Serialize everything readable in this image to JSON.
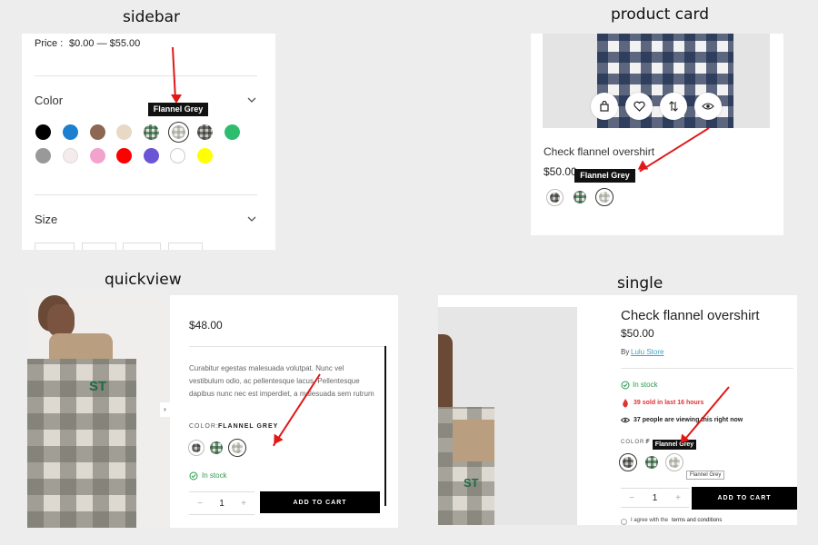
{
  "sections": {
    "sidebar": "sidebar",
    "product_card": "product card",
    "quickview": "quickview",
    "single": "single"
  },
  "sidebar": {
    "price_label": "Price :",
    "price_range": "$0.00 — $55.00",
    "color_heading": "Color",
    "size_heading": "Size",
    "tooltip": "Flannel Grey",
    "swatches": [
      "#000000",
      "#1c7fd0",
      "#8c6752",
      "#e7d9c6",
      "check-green",
      "check-grey",
      "check-black",
      "#2ebd6f",
      "#999999",
      "#f4ecec",
      "#f2a2cc",
      "#ff0000",
      "#6a55d6",
      "#ffffff",
      "#ffff00"
    ]
  },
  "product_card": {
    "name": "Check flannel overshirt",
    "price": "$50.00",
    "tooltip": "Flannel Grey",
    "icons": [
      "shopping-bag-icon",
      "heart-icon",
      "compare-icon",
      "eye-icon"
    ]
  },
  "quickview": {
    "price": "$48.00",
    "description": "Curabitur egestas malesuada volutpat. Nunc vel vestibulum odio, ac pellentesque lacus. Pellentesque dapibus nunc nec est imperdiet, a malesuada sem rutrum",
    "color_label": "COLOR:",
    "color_value": "FLANNEL GREY",
    "stock": "In stock",
    "qty": "1",
    "add_to_cart": "ADD TO CART"
  },
  "single": {
    "title": "Check flannel overshirt",
    "price": "$50.00",
    "by_label": "By",
    "vendor": "Lulu Store",
    "stock": "In stock",
    "sold": "39 sold in last 16 hours",
    "viewing": "37 people are viewing this right now",
    "color_label": "COLOR:",
    "color_value_partial": "F",
    "tooltip": "Flannel Grey",
    "tooltip_small": "Flannel Grey",
    "qty": "1",
    "add_to_cart": "ADD TO CART",
    "terms_prefix": "I agree with the",
    "terms_link": "terms and conditions"
  },
  "colors": {
    "accent_red": "#e01818",
    "stock_green": "#2a9b4d",
    "sold_red": "#e03333",
    "vendor_link": "#3aa7c9"
  }
}
